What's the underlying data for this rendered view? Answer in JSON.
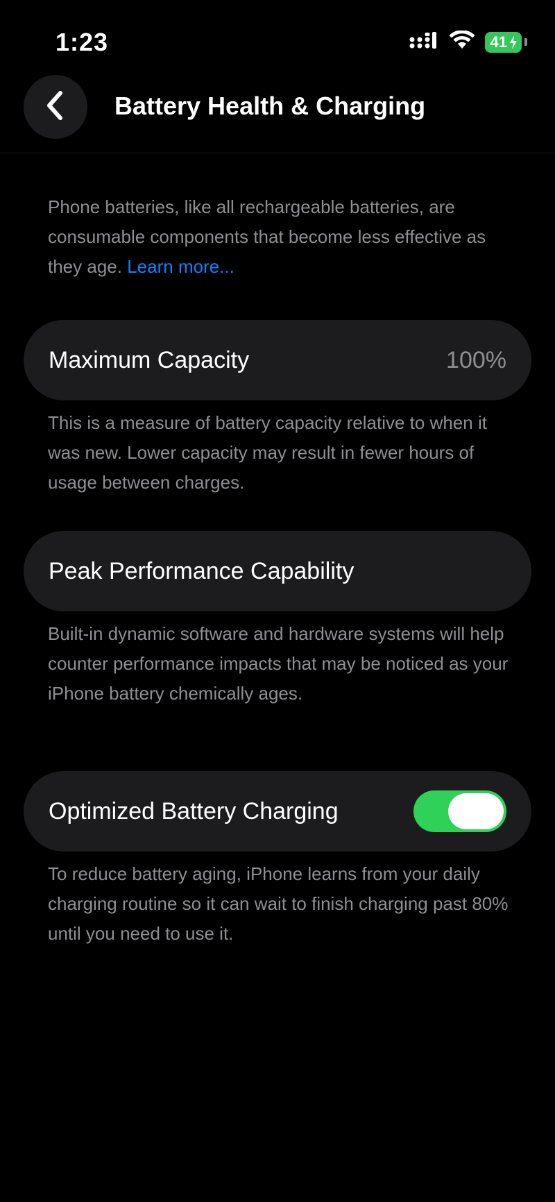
{
  "status_bar": {
    "time": "1:23",
    "battery_level": "41",
    "icons": [
      "cellular-signal-icon",
      "wifi-icon",
      "battery-charging-icon"
    ],
    "battery_color": "#34c759"
  },
  "nav": {
    "title": "Battery Health & Charging",
    "back_icon": "chevron-left-icon"
  },
  "intro": {
    "text": "Phone batteries, like all rechargeable batteries, are consumable components that become less effective as they age.",
    "link": "Learn more..."
  },
  "maximum_capacity": {
    "label": "Maximum Capacity",
    "value": "100%",
    "footnote": "This is a measure of battery capacity relative to when it was new. Lower capacity may result in fewer hours of usage between charges."
  },
  "peak_performance": {
    "label": "Peak Performance Capability",
    "footnote": "Built-in dynamic software and hardware systems will help counter performance impacts that may be noticed as your iPhone battery chemically ages."
  },
  "optimized_charging": {
    "label": "Optimized Battery Charging",
    "enabled": true,
    "toggle_color": "#30d158",
    "footnote": "To reduce battery aging, iPhone learns from your daily charging routine so it can wait to finish charging past 80% until you need to use it."
  },
  "colors": {
    "background": "#000000",
    "cell": "#1c1c1e",
    "secondary_text": "#8e8e93",
    "link": "#0a84ff"
  }
}
